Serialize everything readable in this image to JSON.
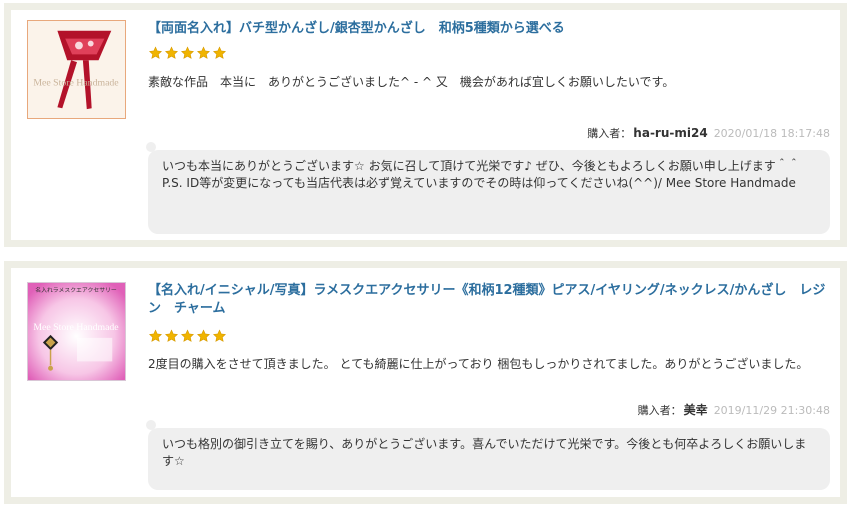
{
  "reviews": [
    {
      "product_title": "【両面名入れ】バチ型かんざし/銀杏型かんざし　和柄5種類から選べる",
      "image_caption": "Mee Store Handmade",
      "rating": 5,
      "body": "素敵な作品　本当に　ありがとうございました^ - ^ 又　機会があれば宜しくお願いしたいです。",
      "buyer_label": "購入者：",
      "buyer_name": "ha-ru-mi24",
      "date": "2020/01/18 18:17:48",
      "reply": "いつも本当にありがとうございます☆ お気に召して頂けて光栄です♪ ぜひ、今後ともよろしくお願い申し上げます＾＾ P.S. ID等が変更になっても当店代表は必ず覚えていますのでその時は仰ってくださいね(^^)/ Mee Store Handmade"
    },
    {
      "product_title": "【名入れ/イニシャル/写真】ラメスクエアクセサリー《和柄12種類》ピアス/イヤリング/ネックレス/かんざし　レジン　チャーム",
      "image_caption": "Mee Store Handmade",
      "image_banner": "名入れラメスクエアクセサリー",
      "rating": 5,
      "body": "2度目の購入をさせて頂きました。 とても綺麗に仕上がっており 梱包もしっかりされてました。ありがとうございました。",
      "buyer_label": "購入者：",
      "buyer_name": "美幸",
      "date": "2019/11/29 21:30:48",
      "reply": "いつも格別の御引き立てを賜り、ありがとうございます。喜んでいただけて光栄です。今後とも何卒よろしくお願いします☆"
    }
  ],
  "colors": {
    "title": "#2c6e9e",
    "star": "#f0b400",
    "card_border": "#eeeee5",
    "reply_bg": "#efefef",
    "date": "#bbbbbb"
  }
}
